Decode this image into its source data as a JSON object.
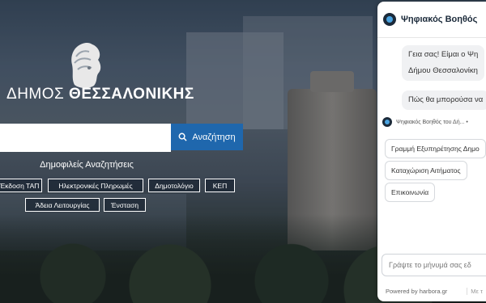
{
  "header": {
    "logo_text_prefix": "ΔΗΜΟΣ",
    "logo_text_bold": "ΘΕΣΣΑΛΟΝΙΚΗΣ"
  },
  "search": {
    "placeholder": "",
    "button_label": "Αναζήτηση"
  },
  "popular": {
    "title": "Δημοφιλείς Αναζητήσεις",
    "items": [
      {
        "label": "Έκδοση ΤΑΠ"
      },
      {
        "label": "Ηλεκτρονικές Πληρωμές"
      },
      {
        "label": "Δημοτολόγιο"
      },
      {
        "label": "ΚΕΠ"
      },
      {
        "label": "Άδεια Λειτουργίας"
      },
      {
        "label": "Ένσταση"
      }
    ]
  },
  "chat": {
    "title": "Ψηφιακός Βοηθός",
    "messages": [
      {
        "line1": "Γεια σας! Είμαι ο Ψη",
        "line2": "Δήμου Θεσσαλονίκη"
      },
      {
        "line1": "Πώς θα μπορούσα να"
      }
    ],
    "bot_name": "Ψηφιακός Βοηθός του Δή... •",
    "quick_replies": [
      {
        "label": "Γραμμή Εξυπηρέτησης Δημο"
      },
      {
        "label": "Καταχώριση Αιτήματος"
      },
      {
        "label": "Επικοινωνία"
      }
    ],
    "input_placeholder": "Γράψτε το μήνυμά σας εδ",
    "powered_by": "Powered by harbora.gr",
    "footer_right": "Με τ"
  },
  "colors": {
    "search_button": "#1f67ad",
    "bot_avatar": "#1b2a3a"
  }
}
